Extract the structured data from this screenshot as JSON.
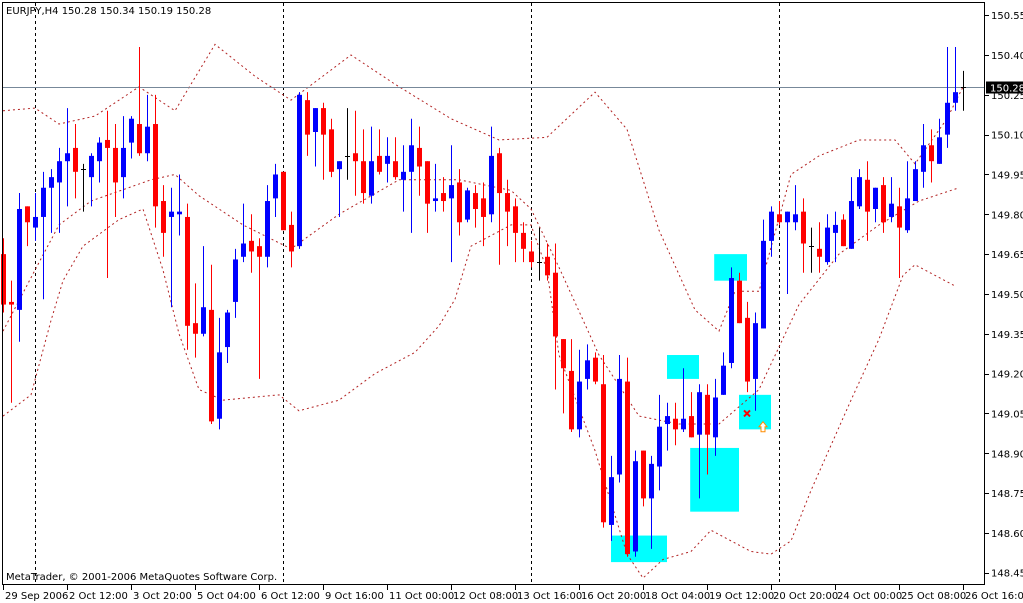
{
  "chart_data": {
    "type": "candlestick",
    "symbol_header": "EURJPY,H4  150.28 150.34 150.19 150.28",
    "symbol": "EURJPY",
    "timeframe": "H4",
    "last_ohlc": [
      150.28,
      150.34,
      150.19,
      150.28
    ],
    "copyright": "MetaTrader, © 2001-2006 MetaQuotes Software Corp.",
    "ylim": [
      148.45,
      150.58
    ],
    "grid": false,
    "y_ticks": [
      "150.55",
      "150.40",
      "150.25",
      "150.10",
      "149.95",
      "149.80",
      "149.65",
      "149.50",
      "149.35",
      "149.20",
      "149.05",
      "148.90",
      "148.75",
      "148.60",
      "148.45"
    ],
    "current_price": "150.28",
    "x_labels": [
      {
        "bar": 0,
        "text": "29 Sep 2006"
      },
      {
        "bar": 8,
        "text": "2 Oct 12:00"
      },
      {
        "bar": 16,
        "text": "3 Oct 20:00"
      },
      {
        "bar": 24,
        "text": "5 Oct 04:00"
      },
      {
        "bar": 32,
        "text": "6 Oct 12:00"
      },
      {
        "bar": 40,
        "text": "9 Oct 16:00"
      },
      {
        "bar": 48,
        "text": "11 Oct 00:00"
      },
      {
        "bar": 56,
        "text": "12 Oct 08:00"
      },
      {
        "bar": 64,
        "text": "13 Oct 16:00"
      },
      {
        "bar": 72,
        "text": "16 Oct 20:00"
      },
      {
        "bar": 80,
        "text": "18 Oct 04:00"
      },
      {
        "bar": 88,
        "text": "19 Oct 12:00"
      },
      {
        "bar": 96,
        "text": "20 Oct 20:00"
      },
      {
        "bar": 104,
        "text": "24 Oct 00:00"
      },
      {
        "bar": 112,
        "text": "25 Oct 08:00"
      },
      {
        "bar": 120,
        "text": "26 Oct 16:00"
      }
    ],
    "period_separators_bars": [
      4,
      35,
      66,
      97
    ],
    "candles_ohlc": [
      [
        149.65,
        149.71,
        149.43,
        149.46
      ],
      [
        149.47,
        149.55,
        149.09,
        149.46
      ],
      [
        149.44,
        149.88,
        149.32,
        149.82
      ],
      [
        149.83,
        149.83,
        149.68,
        149.77
      ],
      [
        149.75,
        149.88,
        149.7,
        149.79
      ],
      [
        149.79,
        149.96,
        149.48,
        149.9
      ],
      [
        149.9,
        149.97,
        149.73,
        149.94
      ],
      [
        149.92,
        150.05,
        149.73,
        150.0
      ],
      [
        150.0,
        150.2,
        149.83,
        150.03
      ],
      [
        150.05,
        150.14,
        149.86,
        149.96
      ],
      [
        149.97,
        149.99,
        149.81,
        149.97
      ],
      [
        149.94,
        150.03,
        149.83,
        150.02
      ],
      [
        150.0,
        150.09,
        149.92,
        150.07
      ],
      [
        150.08,
        150.19,
        149.56,
        150.05
      ],
      [
        150.05,
        150.14,
        149.79,
        149.92
      ],
      [
        149.94,
        150.17,
        149.86,
        150.05
      ],
      [
        150.07,
        150.17,
        150.01,
        150.16
      ],
      [
        150.14,
        150.43,
        150.02,
        150.03
      ],
      [
        150.03,
        150.25,
        150.0,
        150.13
      ],
      [
        150.14,
        150.25,
        149.75,
        149.83
      ],
      [
        149.85,
        149.91,
        149.64,
        149.73
      ],
      [
        149.79,
        149.9,
        149.45,
        149.81
      ],
      [
        149.8,
        149.95,
        149.72,
        149.81
      ],
      [
        149.79,
        149.84,
        149.29,
        149.38
      ],
      [
        149.39,
        149.54,
        149.26,
        149.35
      ],
      [
        149.35,
        149.68,
        149.34,
        149.45
      ],
      [
        149.44,
        149.61,
        149.01,
        149.02
      ],
      [
        149.03,
        149.41,
        148.99,
        149.28
      ],
      [
        149.3,
        149.44,
        149.24,
        149.43
      ],
      [
        149.47,
        149.67,
        149.41,
        149.63
      ],
      [
        149.64,
        149.84,
        149.62,
        149.69
      ],
      [
        149.7,
        149.8,
        149.58,
        149.66
      ],
      [
        149.68,
        149.71,
        149.18,
        149.64
      ],
      [
        149.64,
        149.91,
        149.6,
        149.85
      ],
      [
        149.86,
        149.99,
        149.79,
        149.95
      ],
      [
        149.96,
        149.96,
        149.74,
        149.74
      ],
      [
        149.76,
        149.81,
        149.6,
        149.66
      ],
      [
        149.68,
        150.26,
        149.67,
        150.25
      ],
      [
        150.23,
        150.26,
        150.02,
        150.1
      ],
      [
        150.11,
        150.2,
        149.98,
        150.2
      ],
      [
        150.2,
        150.22,
        149.93,
        150.1
      ],
      [
        150.12,
        150.16,
        149.94,
        149.96
      ],
      [
        149.97,
        150.0,
        149.79,
        150.0
      ],
      [
        150.02,
        150.2,
        149.93,
        150.02
      ],
      [
        150.03,
        150.19,
        149.87,
        150.0
      ],
      [
        150.0,
        150.12,
        149.84,
        149.88
      ],
      [
        149.87,
        150.13,
        149.84,
        150.0
      ],
      [
        150.02,
        150.12,
        149.95,
        149.96
      ],
      [
        149.99,
        150.09,
        149.92,
        150.02
      ],
      [
        150.0,
        150.09,
        149.93,
        149.94
      ],
      [
        149.93,
        150.06,
        149.81,
        149.96
      ],
      [
        149.96,
        150.16,
        149.73,
        150.06
      ],
      [
        150.05,
        150.13,
        149.87,
        149.98
      ],
      [
        150.0,
        150.0,
        149.73,
        149.84
      ],
      [
        149.85,
        149.99,
        149.81,
        149.86
      ],
      [
        149.88,
        149.94,
        149.81,
        149.85
      ],
      [
        149.86,
        150.06,
        149.62,
        149.91
      ],
      [
        149.92,
        149.97,
        149.72,
        149.77
      ],
      [
        149.78,
        149.9,
        149.77,
        149.89
      ],
      [
        149.88,
        149.91,
        149.75,
        149.82
      ],
      [
        149.86,
        149.92,
        149.68,
        149.79
      ],
      [
        149.8,
        150.13,
        149.77,
        150.02
      ],
      [
        150.03,
        150.05,
        149.61,
        149.88
      ],
      [
        149.88,
        149.93,
        149.68,
        149.81
      ],
      [
        149.83,
        149.86,
        149.62,
        149.73
      ],
      [
        149.73,
        149.77,
        149.62,
        149.67
      ],
      [
        149.66,
        149.7,
        149.6,
        149.62
      ],
      [
        149.62,
        149.75,
        149.55,
        149.62
      ],
      [
        149.64,
        149.69,
        149.55,
        149.57
      ],
      [
        149.58,
        149.69,
        149.14,
        149.34
      ],
      [
        149.33,
        149.33,
        149.05,
        149.22
      ],
      [
        149.21,
        149.33,
        148.98,
        148.99
      ],
      [
        148.99,
        149.29,
        148.96,
        149.17
      ],
      [
        149.18,
        149.31,
        149.14,
        149.25
      ],
      [
        149.26,
        149.28,
        149.16,
        149.17
      ],
      [
        149.16,
        149.27,
        148.62,
        148.64
      ],
      [
        148.63,
        148.89,
        148.57,
        148.81
      ],
      [
        148.82,
        149.27,
        148.79,
        149.18
      ],
      [
        149.17,
        149.26,
        148.51,
        148.52
      ],
      [
        148.53,
        148.91,
        148.51,
        148.87
      ],
      [
        148.91,
        148.91,
        148.7,
        148.73
      ],
      [
        148.73,
        148.89,
        148.54,
        148.86
      ],
      [
        148.85,
        149.12,
        148.76,
        149.0
      ],
      [
        149.01,
        149.09,
        148.91,
        149.04
      ],
      [
        149.03,
        149.09,
        148.93,
        148.99
      ],
      [
        148.99,
        149.22,
        148.98,
        149.03
      ],
      [
        149.04,
        149.13,
        148.96,
        148.96
      ],
      [
        148.97,
        149.16,
        148.73,
        149.13
      ],
      [
        149.12,
        149.16,
        148.82,
        148.97
      ],
      [
        148.96,
        149.18,
        148.89,
        149.11
      ],
      [
        149.12,
        149.28,
        149.12,
        149.23
      ],
      [
        149.24,
        149.6,
        149.22,
        149.56
      ],
      [
        149.55,
        149.58,
        149.39,
        149.39
      ],
      [
        149.41,
        149.47,
        149.13,
        149.17
      ],
      [
        149.18,
        149.43,
        149.06,
        149.39
      ],
      [
        149.37,
        149.78,
        149.37,
        149.7
      ],
      [
        149.7,
        149.83,
        149.64,
        149.81
      ],
      [
        149.8,
        149.85,
        149.76,
        149.77
      ],
      [
        149.77,
        149.81,
        149.5,
        149.81
      ],
      [
        149.77,
        149.91,
        149.74,
        149.8
      ],
      [
        149.81,
        149.86,
        149.58,
        149.69
      ],
      [
        149.68,
        149.75,
        149.58,
        149.68
      ],
      [
        149.67,
        149.77,
        149.58,
        149.64
      ],
      [
        149.62,
        149.8,
        149.61,
        149.75
      ],
      [
        149.73,
        149.81,
        149.62,
        149.76
      ],
      [
        149.78,
        149.8,
        149.68,
        149.68
      ],
      [
        149.67,
        149.94,
        149.67,
        149.85
      ],
      [
        149.83,
        149.97,
        149.82,
        149.94
      ],
      [
        149.93,
        150.0,
        149.7,
        149.81
      ],
      [
        149.82,
        149.9,
        149.77,
        149.9
      ],
      [
        149.91,
        149.94,
        149.73,
        149.77
      ],
      [
        149.79,
        149.94,
        149.77,
        149.84
      ],
      [
        149.83,
        149.9,
        149.56,
        149.75
      ],
      [
        149.74,
        150.0,
        149.73,
        149.86
      ],
      [
        149.85,
        150.0,
        149.85,
        149.97
      ],
      [
        149.96,
        150.14,
        149.9,
        150.06
      ],
      [
        150.06,
        150.12,
        149.92,
        150.0
      ],
      [
        149.99,
        150.16,
        149.99,
        150.09
      ],
      [
        150.1,
        150.43,
        150.05,
        150.22
      ],
      [
        150.22,
        150.43,
        150.19,
        150.26
      ],
      [
        150.28,
        150.34,
        150.19,
        150.28
      ]
    ],
    "bollinger": {
      "upper": [
        [
          0,
          150.19
        ],
        [
          4,
          150.2
        ],
        [
          7,
          150.14
        ],
        [
          11.5,
          150.17
        ],
        [
          17,
          150.28
        ],
        [
          21.5,
          150.19
        ],
        [
          26.5,
          150.44
        ],
        [
          31.5,
          150.32
        ],
        [
          36,
          150.23
        ],
        [
          43.5,
          150.4
        ],
        [
          49,
          150.29
        ],
        [
          56,
          150.16
        ],
        [
          62,
          150.08
        ],
        [
          68,
          150.09
        ],
        [
          74,
          150.26
        ],
        [
          78,
          150.12
        ],
        [
          82,
          149.74
        ],
        [
          86.5,
          149.44
        ],
        [
          89.5,
          149.36
        ],
        [
          91.5,
          149.51
        ],
        [
          94.5,
          149.51
        ],
        [
          98.5,
          149.95
        ],
        [
          102,
          150.02
        ],
        [
          107,
          150.08
        ],
        [
          111.5,
          150.08
        ],
        [
          114,
          149.99
        ],
        [
          118,
          150.16
        ],
        [
          120,
          150.28
        ]
      ],
      "middle": [
        [
          0,
          149.36
        ],
        [
          4,
          149.59
        ],
        [
          7,
          149.76
        ],
        [
          11,
          149.85
        ],
        [
          18.5,
          149.93
        ],
        [
          21.5,
          149.95
        ],
        [
          24.5,
          149.87
        ],
        [
          30,
          149.76
        ],
        [
          36,
          149.67
        ],
        [
          42,
          149.8
        ],
        [
          49.5,
          149.93
        ],
        [
          57,
          149.93
        ],
        [
          63.5,
          149.89
        ],
        [
          66,
          149.82
        ],
        [
          69.5,
          149.6
        ],
        [
          74.5,
          149.27
        ],
        [
          79.5,
          149.04
        ],
        [
          84.5,
          149.01
        ],
        [
          89.5,
          149.01
        ],
        [
          94.5,
          149.14
        ],
        [
          99.5,
          149.46
        ],
        [
          104.5,
          149.65
        ],
        [
          109.5,
          149.76
        ],
        [
          114.5,
          149.85
        ],
        [
          119.5,
          149.9
        ]
      ],
      "lower": [
        [
          0,
          149.04
        ],
        [
          3.5,
          149.12
        ],
        [
          6,
          149.4
        ],
        [
          7.5,
          149.55
        ],
        [
          10,
          149.68
        ],
        [
          14.5,
          149.78
        ],
        [
          17.5,
          149.82
        ],
        [
          20,
          149.59
        ],
        [
          22,
          149.35
        ],
        [
          24.5,
          149.14
        ],
        [
          27.5,
          149.1
        ],
        [
          34.5,
          149.12
        ],
        [
          37,
          149.06
        ],
        [
          42,
          149.1
        ],
        [
          46.5,
          149.2
        ],
        [
          51.5,
          149.28
        ],
        [
          54.5,
          149.38
        ],
        [
          56.5,
          149.48
        ],
        [
          58.5,
          149.68
        ],
        [
          63.5,
          149.76
        ],
        [
          66,
          149.76
        ],
        [
          68,
          149.59
        ],
        [
          69.5,
          149.27
        ],
        [
          74,
          148.91
        ],
        [
          78,
          148.52
        ],
        [
          80,
          148.43
        ],
        [
          82.5,
          148.5
        ],
        [
          86,
          148.53
        ],
        [
          88.5,
          148.61
        ],
        [
          93.5,
          148.53
        ],
        [
          96,
          148.52
        ],
        [
          98.5,
          148.57
        ],
        [
          101,
          148.76
        ],
        [
          106,
          149.1
        ],
        [
          109.5,
          149.33
        ],
        [
          112.5,
          149.57
        ],
        [
          114,
          149.61
        ],
        [
          119,
          149.53
        ]
      ]
    },
    "highlight_zones": [
      {
        "from_bar": 76,
        "to_bar": 83,
        "high": 148.59,
        "low": 148.49
      },
      {
        "from_bar": 83,
        "to_bar": 87,
        "high": 149.27,
        "low": 149.18
      },
      {
        "from_bar": 85.9,
        "to_bar": 92,
        "high": 148.92,
        "low": 148.68
      },
      {
        "from_bar": 88.9,
        "to_bar": 93,
        "high": 149.65,
        "low": 149.55
      },
      {
        "from_bar": 92,
        "to_bar": 96,
        "high": 149.12,
        "low": 148.99
      }
    ],
    "signals": [
      {
        "type": "cross",
        "bar": 93,
        "price": 149.05
      },
      {
        "type": "up-arrow",
        "bar": 95,
        "price": 149.0
      }
    ],
    "colors": {
      "bull": "#0000ff",
      "bear": "#ff0000",
      "doji": "#000000",
      "band": "#b22222",
      "zone": "#00ffff",
      "price_line": "#778899"
    }
  }
}
